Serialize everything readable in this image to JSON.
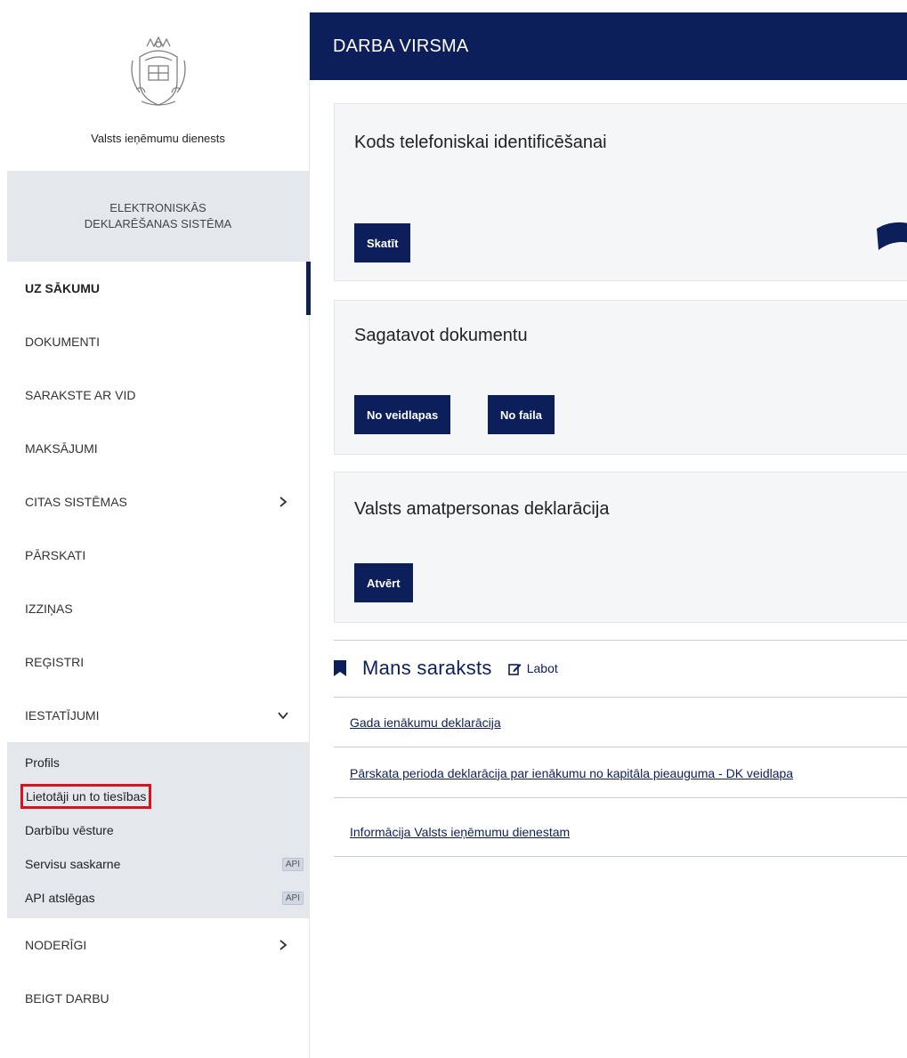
{
  "sidebar": {
    "org_name": "Valsts ieņēmumu dienests",
    "system_line1": "ELEKTRONISKĀS",
    "system_line2": "DEKLARĒŠANAS SISTĒMA",
    "items": [
      {
        "label": "UZ SĀKUMU",
        "active": true
      },
      {
        "label": "DOKUMENTI"
      },
      {
        "label": "SARAKSTE AR VID"
      },
      {
        "label": "MAKSĀJUMI"
      },
      {
        "label": "CITAS SISTĒMAS",
        "icon": "chevron-right-icon"
      },
      {
        "label": "PĀRSKATI"
      },
      {
        "label": "IZZIŅAS"
      },
      {
        "label": "REĢISTRI"
      },
      {
        "label": "IESTATĪJUMI",
        "icon": "chevron-down-icon"
      }
    ],
    "subitems": [
      {
        "label": "Profils"
      },
      {
        "label": "Lietotāji un to tiesības",
        "highlighted": true
      },
      {
        "label": "Darbību vēsture"
      },
      {
        "label": "Servisu saskarne",
        "badge": "API"
      },
      {
        "label": "API atslēgas",
        "badge": "API"
      }
    ],
    "bottom_items": [
      {
        "label": "NODERĪGI",
        "icon": "chevron-right-icon"
      },
      {
        "label": "BEIGT DARBU"
      }
    ]
  },
  "header": {
    "title": "DARBA VIRSMA"
  },
  "cards": [
    {
      "title": "Kods telefoniskai identificēšanai",
      "buttons": [
        "Skatīt"
      ]
    },
    {
      "title": "Sagatavot dokumentu",
      "buttons": [
        "No veidlapas",
        "No faila"
      ]
    },
    {
      "title": "Valsts amatpersonas deklarācija",
      "buttons": [
        "Atvērt"
      ]
    }
  ],
  "my_list": {
    "title": "Mans saraksts",
    "edit_label": "Labot",
    "links": [
      "Gada ienākumu deklarācija",
      "Pārskata perioda deklarācija par ienākumu no kapitāla pieauguma - DK veidlapa",
      "Informācija Valsts ieņēmumu dienestam"
    ]
  },
  "colors": {
    "brand_navy": "#0d1f5a",
    "sidebar_panel": "#e4e7ec",
    "highlight_red": "#e0101a"
  }
}
